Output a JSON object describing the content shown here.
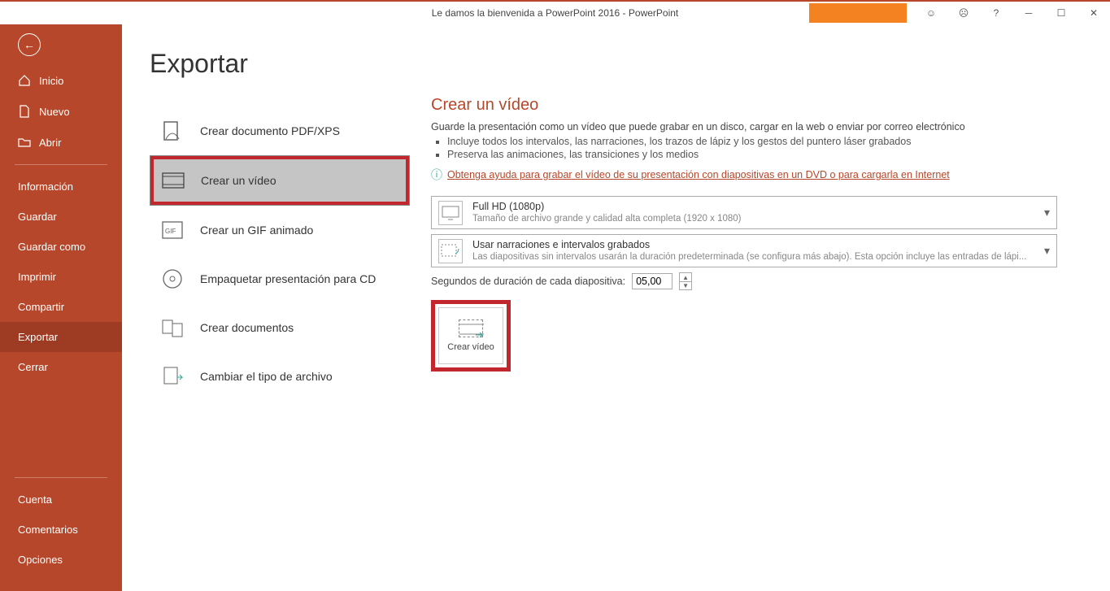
{
  "titlebar": {
    "title": "Le damos la bienvenida a PowerPoint 2016  -  PowerPoint"
  },
  "sidebar": {
    "inicio": "Inicio",
    "nuevo": "Nuevo",
    "abrir": "Abrir",
    "informacion": "Información",
    "guardar": "Guardar",
    "guardar_como": "Guardar como",
    "imprimir": "Imprimir",
    "compartir": "Compartir",
    "exportar": "Exportar",
    "cerrar": "Cerrar",
    "cuenta": "Cuenta",
    "comentarios": "Comentarios",
    "opciones": "Opciones"
  },
  "page": {
    "title": "Exportar"
  },
  "export_options": {
    "pdf": "Crear documento PDF/XPS",
    "video": "Crear un vídeo",
    "gif": "Crear un GIF animado",
    "cd": "Empaquetar presentación para CD",
    "docs": "Crear documentos",
    "filetype": "Cambiar el tipo de archivo"
  },
  "video_panel": {
    "title": "Crear un vídeo",
    "desc": "Guarde la presentación como un vídeo que puede grabar en un disco, cargar en la web o enviar por correo electrónico",
    "bullet1": "Incluye todos los intervalos, las narraciones, los trazos de lápiz y los gestos del puntero láser grabados",
    "bullet2": "Preserva las animaciones, las transiciones y los medios",
    "help_link": "Obtenga ayuda para grabar el vídeo de su presentación con diapositivas en un DVD o para cargarla en Internet",
    "quality_main": "Full HD (1080p)",
    "quality_sub": "Tamaño de archivo grande y calidad alta completa (1920 x 1080)",
    "narr_main": "Usar narraciones e intervalos grabados",
    "narr_sub": "Las diapositivas sin intervalos usarán la duración predeterminada (se configura más abajo). Esta opción incluye las entradas de lápi...",
    "seconds_label": "Segundos de duración de cada diapositiva:",
    "seconds_value": "05,00",
    "create_button": "Crear vídeo"
  }
}
